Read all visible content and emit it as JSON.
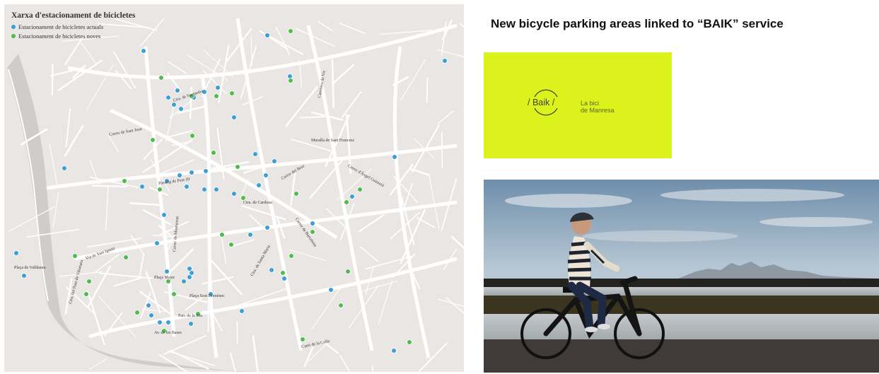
{
  "map": {
    "legend_title": "Xarxa d'estacionament de bicicletes",
    "legend_current": "Estacionament de bicicletes actuals",
    "legend_new": "Estacionament de bicicletes noves",
    "colors": {
      "current": "#3b9fd6",
      "new": "#4fbb4a",
      "ground": "#e9e6e3",
      "streets": "#ffffff",
      "river": "#c9c7c6"
    },
    "street_labels": [
      "Ctra. de Santpedor",
      "Carrer de Sant Joan",
      "Passeig de Pere III",
      "Carretera de Vic",
      "Carrer del Bruc",
      "Muralla de Sant Francesc",
      "Carrer d'Àngel Guimerà",
      "Ctra. de Cardona",
      "Carrer de Barcelona",
      "Ctra. de Santa Maria",
      "Plaça Major",
      "Ctra. del Pont de Vilomara",
      "Via de Sant Ignasi",
      "Plaça Sant Domènec",
      "Parc de la Seu",
      "Av. de les Bases",
      "Camí de la Culla",
      "Carrer de Montserrat",
      "Plaça de Valldaura"
    ]
  },
  "headline": "New bicycle parking areas linked to “BAIK” service",
  "baik": {
    "brand": "/ Baik /",
    "tagline_1": "La bici",
    "tagline_2": "de Manresa",
    "background": "#dcf21c"
  },
  "photo": {
    "subject": "cyclist-on-e-bike-by-water"
  }
}
